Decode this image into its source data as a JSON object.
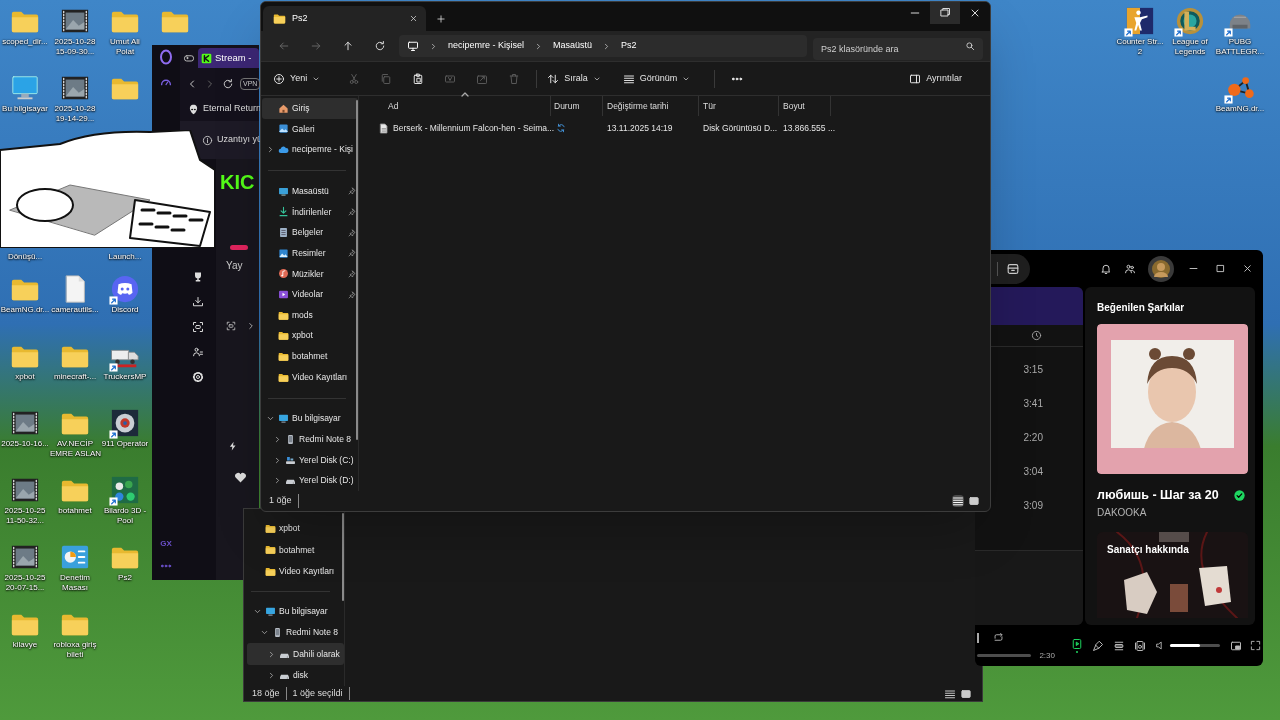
{
  "desktop": {
    "left_columns": [
      [
        {
          "label": "scoped_dir...",
          "kind": "folder",
          "shortcut": false
        },
        {
          "label": "Bu bilgisayar",
          "kind": "computer",
          "shortcut": false
        },
        null,
        {
          "label": "Dönüşü...",
          "kind": "hidden"
        },
        {
          "label": "BeamNG.dr...",
          "kind": "folder",
          "shortcut": false
        },
        {
          "label": "xpbot",
          "kind": "folder",
          "shortcut": false
        },
        {
          "label": "2025-10-16...",
          "kind": "video",
          "shortcut": false
        },
        {
          "label": "2025-10-25\n11-50-32...",
          "kind": "video",
          "shortcut": false
        },
        {
          "label": "2025-10-25\n20-07-15...",
          "kind": "video",
          "shortcut": false
        },
        {
          "label": "kilavye",
          "kind": "folder",
          "shortcut": false
        }
      ],
      [
        {
          "label": "2025-10-28\n15-09-30...",
          "kind": "video",
          "shortcut": false
        },
        {
          "label": "2025-10-28\n19-14-29...",
          "kind": "video",
          "shortcut": false
        },
        null,
        null,
        {
          "label": "camerautils...",
          "kind": "file",
          "shortcut": false
        },
        {
          "label": "minecraft-...",
          "kind": "folder",
          "shortcut": false
        },
        {
          "label": "AV.NECİP\nEMRE ASLAN",
          "kind": "folder",
          "shortcut": false
        },
        {
          "label": "botahmet",
          "kind": "folder",
          "shortcut": false
        },
        {
          "label": "Denetim\nMasası",
          "kind": "control",
          "shortcut": false
        },
        {
          "label": "robloxa giriş\nbileti",
          "kind": "folder",
          "shortcut": false
        }
      ],
      [
        {
          "label": "Umut Ali\nPolat",
          "kind": "folder",
          "shortcut": false
        },
        {
          "kind": "folder",
          "shortcut": false
        },
        null,
        {
          "label": "Launch...",
          "kind": "hidden"
        },
        {
          "label": "Discord",
          "kind": "discord",
          "shortcut": true
        },
        {
          "label": "TruckersMP",
          "kind": "truck",
          "shortcut": true
        },
        {
          "label": "911 Operator",
          "kind": "badge",
          "shortcut": true
        },
        {
          "label": "Bilardo 3D -\nPool",
          "kind": "pool",
          "shortcut": true
        },
        {
          "label": "Ps2",
          "kind": "folder",
          "shortcut": false
        }
      ],
      [
        {
          "kind": "folder",
          "shortcut": false
        }
      ]
    ],
    "right_columns": [
      [
        {
          "label": "Counter Str...\n2",
          "kind": "cs",
          "shortcut": true
        }
      ],
      [
        {
          "label": "League of\nLegends",
          "kind": "lol",
          "shortcut": true
        }
      ],
      [
        {
          "label": "PUBG\nBATTLEGR...",
          "kind": "pubg",
          "shortcut": true
        },
        {
          "label": "BeamNG.dr...",
          "kind": "beamng",
          "shortcut": true
        }
      ]
    ]
  },
  "browser": {
    "tab": {
      "title": "Stream -"
    },
    "vpn": "VPN",
    "bookmark": "Eternal Return",
    "extension_bar": "Uzantıyı yü",
    "site_logo": "KIC",
    "stream_label": "Yay",
    "sidebar_label": "GX"
  },
  "background_explorer": {
    "sidebar": [
      [
        {
          "label": "xpbot",
          "kind": "folder",
          "selected": false
        },
        {
          "label": "botahmet",
          "kind": "folder",
          "selected": false
        },
        {
          "label": "Video Kayıtları",
          "kind": "folder",
          "selected": false
        }
      ],
      [
        {
          "label": "Bu bilgisayar",
          "kind": "pc",
          "selected": false,
          "expanded": true,
          "children": [
            {
              "label": "Redmi Note 8",
              "kind": "phone",
              "selected": false,
              "expanded": true,
              "children": [
                {
                  "label": "Dahili olarak",
                  "kind": "drive",
                  "selected": true,
                  "expanded": false
                },
                {
                  "label": "disk",
                  "kind": "drive",
                  "selected": false,
                  "expanded": false
                }
              ]
            }
          ]
        }
      ]
    ],
    "status": {
      "count": "18 öğe",
      "selection": "1 öğe seçildi"
    },
    "views": [
      {
        "kind": "details",
        "selected": false
      },
      {
        "kind": "tiles",
        "selected": false
      }
    ]
  },
  "music_player": {
    "durations": [
      "3:15",
      "3:41",
      "2:20",
      "3:04",
      "3:09"
    ],
    "panel_title": "Beğenilen Şarkılar",
    "track": {
      "title": "любишь - Шаг за 20",
      "artist": "DAKOOKA",
      "saved": true
    },
    "artist_card": {
      "title": "Sanatçı hakkında"
    },
    "duration": "2:30",
    "controls": [
      {
        "kind": "now_playing",
        "active": true
      },
      {
        "kind": "lyrics",
        "active": false
      },
      {
        "kind": "queue",
        "active": false
      },
      {
        "kind": "devices",
        "active": false
      }
    ],
    "volume": {
      "level": 0.6
    }
  },
  "file_explorer": {
    "tab": {
      "title": "Ps2"
    },
    "breadcrumb": [
      "necipemre - Kişisel",
      "Masaüstü",
      "Ps2"
    ],
    "search": {
      "placeholder": "Ps2 klasöründe ara"
    },
    "toolbar": [
      {
        "kind": "new",
        "label": "Yeni",
        "disabled": false
      },
      {
        "kind": "cut",
        "disabled": true
      },
      {
        "kind": "copy",
        "disabled": true
      },
      {
        "kind": "paste",
        "disabled": false
      },
      {
        "kind": "rename",
        "disabled": true
      },
      {
        "kind": "share",
        "disabled": true
      },
      {
        "kind": "delete",
        "disabled": true
      },
      {
        "kind": "sort",
        "label": "Sırala",
        "disabled": false
      },
      {
        "kind": "view",
        "label": "Görünüm",
        "disabled": false
      },
      {
        "kind": "more",
        "disabled": false
      },
      {
        "kind": "details",
        "label": "Ayrıntılar",
        "disabled": false
      }
    ],
    "sidebar": [
      [
        {
          "label": "Giriş",
          "kind": "home",
          "selected": true,
          "pinned": false
        },
        {
          "label": "Galeri",
          "kind": "gallery",
          "selected": false,
          "pinned": false
        },
        {
          "label": "necipemre - Kişi",
          "kind": "cloud",
          "selected": false,
          "pinned": false,
          "expanded": false
        }
      ],
      [
        {
          "label": "Masaüstü",
          "kind": "desktop",
          "selected": false,
          "pinned": true
        },
        {
          "label": "İndirilenler",
          "kind": "download",
          "selected": false,
          "pinned": true
        },
        {
          "label": "Belgeler",
          "kind": "docs",
          "selected": false,
          "pinned": true
        },
        {
          "label": "Resimler",
          "kind": "pictures",
          "selected": false,
          "pinned": true
        },
        {
          "label": "Müzikler",
          "kind": "music",
          "selected": false,
          "pinned": true
        },
        {
          "label": "Videolar",
          "kind": "videos",
          "selected": false,
          "pinned": true
        },
        {
          "label": "mods",
          "kind": "folder",
          "selected": false,
          "pinned": false
        },
        {
          "label": "xpbot",
          "kind": "folder",
          "selected": false,
          "pinned": false
        },
        {
          "label": "botahmet",
          "kind": "folder",
          "selected": false,
          "pinned": false
        },
        {
          "label": "Video Kayıtları",
          "kind": "folder",
          "selected": false,
          "pinned": false
        }
      ],
      [
        {
          "label": "Bu bilgisayar",
          "kind": "pc",
          "selected": false,
          "pinned": false,
          "expanded": true,
          "children": [
            {
              "label": "Redmi Note 8",
              "kind": "phone",
              "selected": false,
              "pinned": false,
              "expanded": false
            },
            {
              "label": "Yerel Disk (C:)",
              "kind": "drive_c",
              "selected": false,
              "pinned": false,
              "expanded": false
            },
            {
              "label": "Yerel Disk (D:)",
              "kind": "drive",
              "selected": false,
              "pinned": false,
              "expanded": false
            }
          ]
        }
      ]
    ],
    "columns": [
      "Ad",
      "Durum",
      "Değiştirme tarihi",
      "Tür",
      "Boyut"
    ],
    "rows": [
      {
        "name": "Berserk - Millennium Falcon-hen - Seima...",
        "syncing": true,
        "modified": "13.11.2025 14:19",
        "type": "Disk Görüntüsü D...",
        "size": "13.866.555 ...",
        "selected": false
      }
    ],
    "status": {
      "count": "1 öğe"
    },
    "views": [
      {
        "kind": "details",
        "selected": true
      },
      {
        "kind": "tiles",
        "selected": false
      }
    ]
  }
}
